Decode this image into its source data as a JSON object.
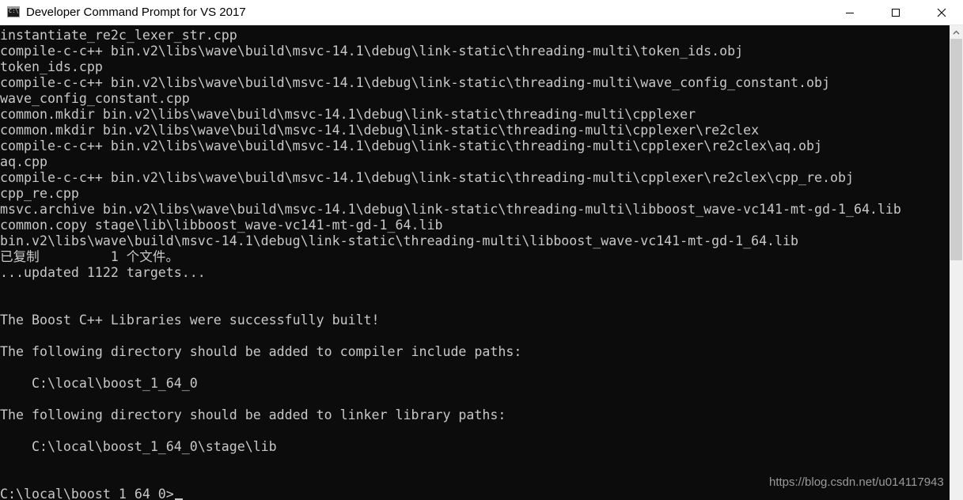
{
  "window": {
    "title": "Developer Command Prompt for VS 2017",
    "icon": "cmd-icon",
    "icon_text": "C:\\",
    "controls": [
      "minimize-icon",
      "maximize-icon",
      "close-icon"
    ]
  },
  "console": {
    "lines": [
      "instantiate_re2c_lexer_str.cpp",
      "compile-c-c++ bin.v2\\libs\\wave\\build\\msvc-14.1\\debug\\link-static\\threading-multi\\token_ids.obj",
      "token_ids.cpp",
      "compile-c-c++ bin.v2\\libs\\wave\\build\\msvc-14.1\\debug\\link-static\\threading-multi\\wave_config_constant.obj",
      "wave_config_constant.cpp",
      "common.mkdir bin.v2\\libs\\wave\\build\\msvc-14.1\\debug\\link-static\\threading-multi\\cpplexer",
      "common.mkdir bin.v2\\libs\\wave\\build\\msvc-14.1\\debug\\link-static\\threading-multi\\cpplexer\\re2clex",
      "compile-c-c++ bin.v2\\libs\\wave\\build\\msvc-14.1\\debug\\link-static\\threading-multi\\cpplexer\\re2clex\\aq.obj",
      "aq.cpp",
      "compile-c-c++ bin.v2\\libs\\wave\\build\\msvc-14.1\\debug\\link-static\\threading-multi\\cpplexer\\re2clex\\cpp_re.obj",
      "cpp_re.cpp",
      "msvc.archive bin.v2\\libs\\wave\\build\\msvc-14.1\\debug\\link-static\\threading-multi\\libboost_wave-vc141-mt-gd-1_64.lib",
      "common.copy stage\\lib\\libboost_wave-vc141-mt-gd-1_64.lib",
      "bin.v2\\libs\\wave\\build\\msvc-14.1\\debug\\link-static\\threading-multi\\libboost_wave-vc141-mt-gd-1_64.lib",
      "已复制         1 个文件。",
      "...updated 1122 targets...",
      "",
      "",
      "The Boost C++ Libraries were successfully built!",
      "",
      "The following directory should be added to compiler include paths:",
      "",
      "    C:\\local\\boost_1_64_0",
      "",
      "The following directory should be added to linker library paths:",
      "",
      "    C:\\local\\boost_1_64_0\\stage\\lib",
      "",
      ""
    ],
    "prompt": "C:\\local\\boost_1_64_0>"
  },
  "scrollbar": {
    "arrow_icon": "scroll-up-arrow-icon"
  },
  "watermark": "https://blog.csdn.net/u014117943"
}
